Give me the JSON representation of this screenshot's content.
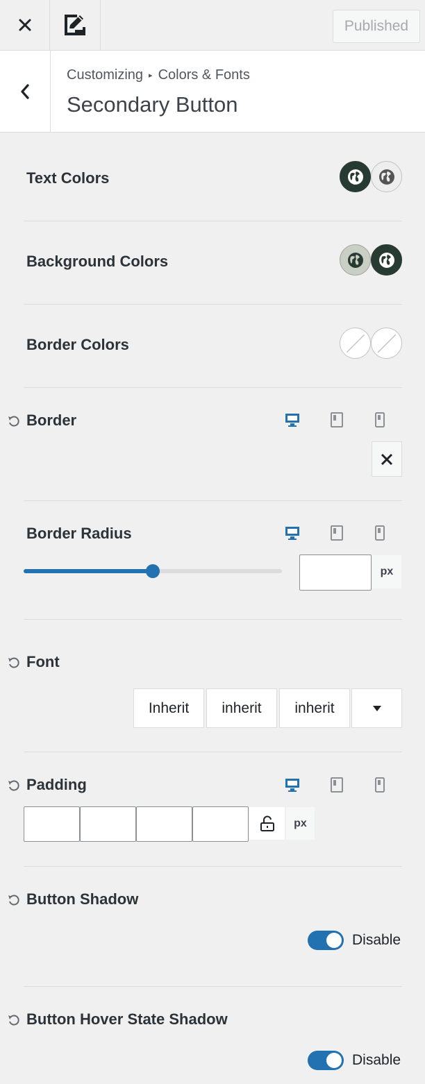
{
  "topbar": {
    "close_icon": "close-icon",
    "brush_icon": "customize-brush-icon",
    "publish_label": "Published"
  },
  "header": {
    "back_icon": "chevron-left-icon",
    "breadcrumb_root": "Customizing",
    "breadcrumb_sep": "▸",
    "breadcrumb_parent": "Colors & Fonts",
    "title": "Secondary Button"
  },
  "controls": {
    "text_colors": {
      "label": "Text Colors",
      "swatches": [
        "#283b33",
        "#eeeeee"
      ]
    },
    "background_colors": {
      "label": "Background Colors",
      "swatches": [
        "#c9cfc4",
        "#283b33"
      ]
    },
    "border_colors": {
      "label": "Border Colors"
    },
    "border": {
      "label": "Border",
      "clear_icon": "close-x-icon"
    },
    "border_radius": {
      "label": "Border Radius",
      "value": "",
      "unit": "px",
      "slider_fraction": 0.5
    },
    "font": {
      "label": "Font",
      "family": "Inherit",
      "weight": "inherit",
      "style": "inherit",
      "dropdown_icon": "caret-down-icon"
    },
    "padding": {
      "label": "Padding",
      "values": [
        "",
        "",
        "",
        ""
      ],
      "lock_icon": "unlock-icon",
      "unit": "px"
    },
    "button_shadow": {
      "label": "Button Shadow",
      "toggle_label": "Disable"
    },
    "button_hover_shadow": {
      "label": "Button Hover State Shadow",
      "toggle_label": "Disable"
    }
  },
  "colors": {
    "accent": "#2271b1",
    "swatch_dark": "#283b33",
    "swatch_light": "#c9cfc4"
  }
}
